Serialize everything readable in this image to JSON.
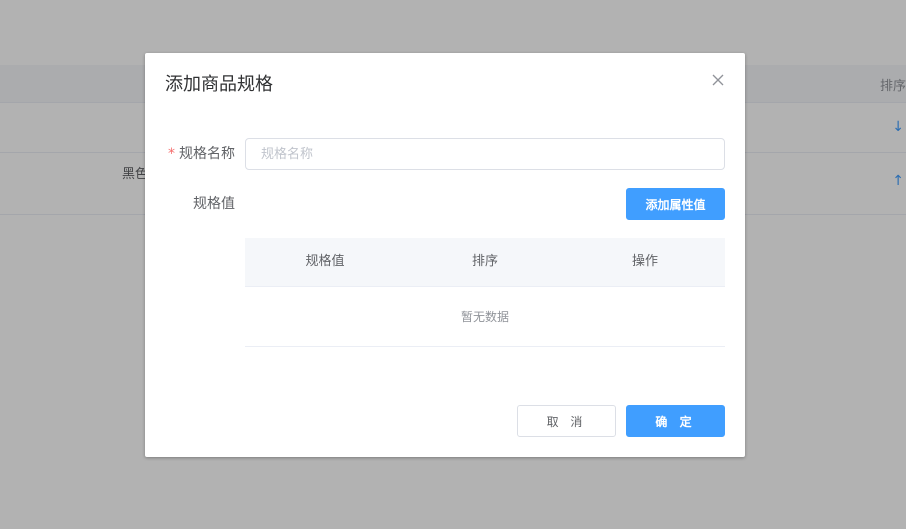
{
  "background": {
    "header_sort_label": "排序",
    "row2_text": "黑色",
    "row1_arrow": "↓",
    "row2_arrow": "↑"
  },
  "dialog": {
    "title": "添加商品规格",
    "close_icon": "close-icon",
    "form": {
      "required_mark": "*",
      "name_label": "规格名称",
      "name_value": "",
      "name_placeholder": "规格名称",
      "values_label": "规格值",
      "add_button_label": "添加属性值"
    },
    "table": {
      "columns": [
        "规格值",
        "排序",
        "操作"
      ],
      "empty_text": "暂无数据"
    },
    "footer": {
      "cancel_label": "取 消",
      "confirm_label": "确 定"
    }
  },
  "colors": {
    "primary": "#409eff",
    "required": "#f56c6c",
    "overlay": "rgba(0,0,0,0.3)"
  }
}
